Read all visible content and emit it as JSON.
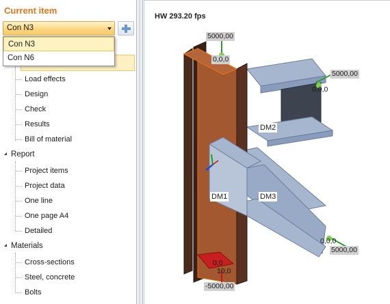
{
  "current_item": {
    "title": "Current item",
    "selected": "Con N3",
    "options": [
      "Con N3",
      "Con N6"
    ]
  },
  "tree": {
    "items_top": [
      "Load effects",
      "Design",
      "Check",
      "Results",
      "Bill of material"
    ],
    "report": {
      "label": "Report",
      "items": [
        "Project items",
        "Project data",
        "One line",
        "One page A4",
        "Detailed"
      ]
    },
    "materials": {
      "label": "Materials",
      "items": [
        "Cross-sections",
        "Steel, concrete",
        "Bolts"
      ]
    }
  },
  "viewport": {
    "fps_text": "HW 293.20 fps",
    "labels": {
      "dm1": "DM1",
      "dm2": "DM2",
      "dm3": "DM3"
    },
    "values": {
      "top_load": "5000,00",
      "top_origin": "0,0,0",
      "dm2_load": "5000,00",
      "dm2_origin": "0,0,0",
      "dm3_load": "5000,00",
      "dm3_origin": "0,0,0",
      "bottom_load": "-5000,00",
      "bottom_origin1": "0,0",
      "bottom_origin2": "10,0"
    }
  },
  "colors": {
    "accent": "#e8731a",
    "column": "#9a5230",
    "beam": "#8ea3c4"
  }
}
